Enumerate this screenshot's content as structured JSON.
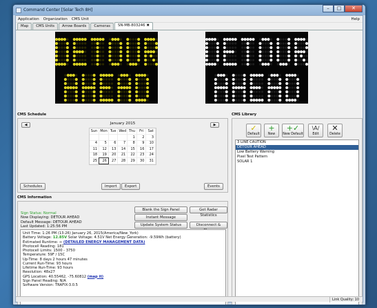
{
  "window": {
    "title": "Command Center [Solar Tech 8H]",
    "buttons": {
      "minimize": "–",
      "maximize": "□",
      "close": "✕"
    }
  },
  "menu": {
    "items": [
      "Application",
      "Organization",
      "CMS Unit"
    ],
    "help": "Help"
  },
  "tabs": [
    {
      "label": "Map"
    },
    {
      "label": "CMS Units"
    },
    {
      "label": "Arrow Boards"
    },
    {
      "label": "Cameras"
    },
    {
      "label": "SN-MB-803246",
      "closable": true
    }
  ],
  "signs": {
    "line1": "DETOUR",
    "line2": "AHEAD",
    "colors": {
      "left": "#d8d020",
      "right": "#e8e8e8",
      "background": "#050505",
      "left_dim": "#2a2800",
      "right_dim": "#1e1e1e"
    }
  },
  "schedule": {
    "label": "CMS Schedule",
    "month": "January 2015",
    "prev": "◀",
    "next": "▶",
    "dow": [
      "Sun",
      "Mon",
      "Tue",
      "Wed",
      "Thu",
      "Fri",
      "Sat"
    ],
    "weeks": [
      [
        "",
        "",
        "",
        "",
        "1",
        "2",
        "3"
      ],
      [
        "4",
        "5",
        "6",
        "7",
        "8",
        "9",
        "10"
      ],
      [
        "11",
        "12",
        "13",
        "14",
        "15",
        "16",
        "17"
      ],
      [
        "18",
        "19",
        "20",
        "21",
        "22",
        "23",
        "24"
      ],
      [
        "25",
        "26",
        "27",
        "28",
        "29",
        "30",
        "31"
      ]
    ],
    "today": "26",
    "buttons": {
      "schedules": "Schedules",
      "import": "Import",
      "export": "Export",
      "events": "Events"
    }
  },
  "information": {
    "label": "CMS Information",
    "sign_status": "Sign Status: Normal",
    "now_displaying": "Now Displaying: DETOUR AHEAD",
    "default_message": "Default Message: DETOUR AHEAD",
    "last_updated": "Last Updated: 1:25:56 PM",
    "buttons": {
      "blank": "Blank the Sign Panel",
      "radar": "Get Radar Statistics",
      "instant": "Instant Message",
      "update": "Update System Status",
      "disconnect": "Disconnect & Close"
    },
    "details": {
      "unit_time": "Unit Time: 1:26 PM (13:26) January 26, 2015(America/New_York)",
      "battery_prefix": "Battery Voltage: ",
      "battery_value": "12.85V",
      "battery_suffix": " Solar Voltage: 4.51V Net Energy Generation: -9.59Wh (battery)",
      "runtime_prefix": "Estimated Runtime: ∞ ",
      "runtime_link": "(DETAILED ENERGY MANAGEMENT DATA)",
      "photocell": "Photocell Reading: 181",
      "photocell_limits": "Photocell Limits: 1500 - 3750",
      "temperature": "Temperature: 59F / 15C",
      "uptime": "Up-Time: 8 days 2 hours 47 minutes",
      "current_runtime": "Current Run-Time: 93 hours",
      "lifetime_runtime": "Lifetime Run-Time: 93 hours",
      "resolution": "Resolution: 48x27",
      "gps_prefix": "GPS Location: 40.55462, -75.60812 ",
      "gps_link": "(map it)",
      "heading": "Sign Panel Heading: N/A",
      "software": "Software Version: TRAFIX-3.0.5"
    }
  },
  "library": {
    "label": "CMS Library",
    "toolbar": [
      {
        "label": "Default",
        "icon": "check-icon",
        "glyph": "✓",
        "color": "#c8b400"
      },
      {
        "label": "New",
        "icon": "plus-icon",
        "glyph": "+",
        "color": "#2a9a2a"
      },
      {
        "label": "New Default",
        "icon": "plus-check-icon",
        "glyph": "+✓",
        "color": "#2a9a2a"
      },
      {
        "label": "Edit",
        "icon": "edit-icon",
        "glyph": "\\A/",
        "color": "#333333"
      },
      {
        "label": "Delete",
        "icon": "delete-icon",
        "glyph": "✕",
        "color": "#222222"
      }
    ],
    "items": [
      "3 LINE CAUTION",
      "DETOUR AHEAD",
      "Low Battery Warning",
      "Pixel Test Pattern",
      "SOLAR 1"
    ],
    "selected": "DETOUR AHEAD"
  },
  "statusbar": {
    "link_quality": "Link Quality: 10"
  }
}
